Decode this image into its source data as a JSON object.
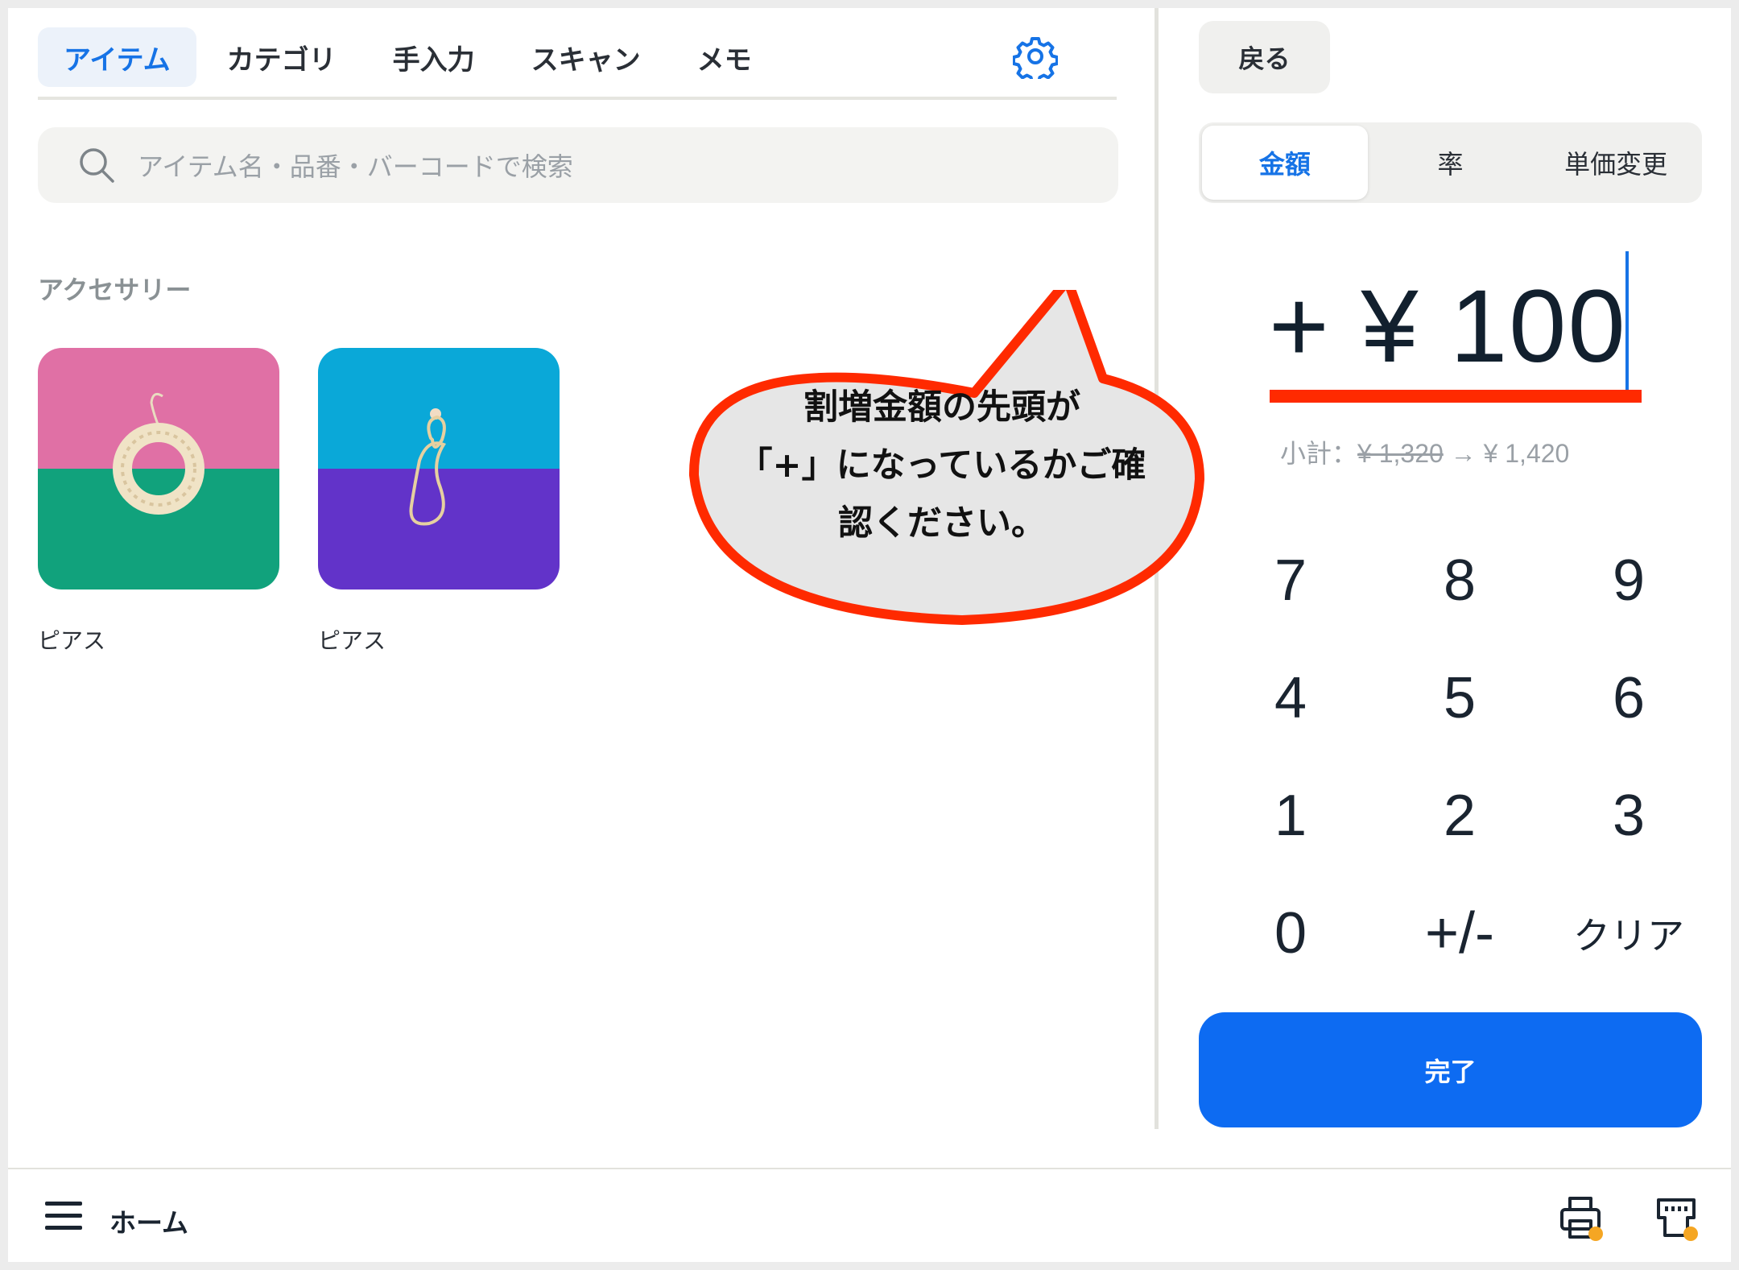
{
  "tabs": [
    {
      "label": "アイテム",
      "active": true
    },
    {
      "label": "カテゴリ",
      "active": false
    },
    {
      "label": "手入力",
      "active": false
    },
    {
      "label": "スキャン",
      "active": false
    },
    {
      "label": "メモ",
      "active": false
    }
  ],
  "search": {
    "placeholder": "アイテム名・品番・バーコードで検索"
  },
  "section": {
    "title": "アクセサリー"
  },
  "items": [
    {
      "label": "ピアス",
      "top_color": "#e070a5",
      "bottom_color": "#11a27c"
    },
    {
      "label": "ピアス",
      "top_color": "#0aa8d8",
      "bottom_color": "#6233c9"
    }
  ],
  "right": {
    "back_label": "戻る",
    "segments": [
      {
        "label": "金額",
        "active": true
      },
      {
        "label": "率",
        "active": false
      },
      {
        "label": "単価変更",
        "active": false
      }
    ],
    "amount": "+ ¥ 100",
    "subtotal_label": "小計：",
    "subtotal_old": "¥ 1,320",
    "subtotal_arrow": "→",
    "subtotal_new": "¥ 1,420",
    "keypad": [
      "7",
      "8",
      "9",
      "4",
      "5",
      "6",
      "1",
      "2",
      "3",
      "0",
      "+/-",
      "クリア"
    ],
    "done_label": "完了"
  },
  "callout": {
    "lines": [
      "割増金額の先頭が",
      "「+」になっているかご確",
      "認ください。"
    ]
  },
  "bottom_bar": {
    "home_label": "ホーム"
  },
  "colors": {
    "accent": "#1673e6",
    "primary_button": "#0d6bf2",
    "highlight": "#ff2a00",
    "status_dot": "#f5a623"
  },
  "icons": [
    "gear-icon",
    "search-icon",
    "menu-icon",
    "printer-icon",
    "card-reader-icon"
  ]
}
